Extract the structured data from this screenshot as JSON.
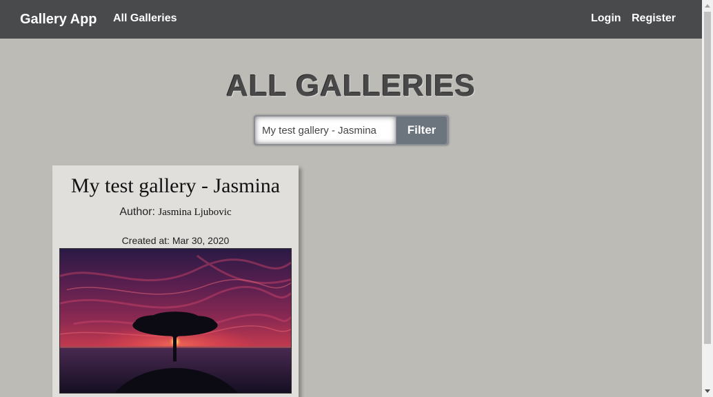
{
  "nav": {
    "brand": "Gallery App",
    "all_galleries": "All Galleries",
    "login": "Login",
    "register": "Register"
  },
  "page": {
    "title": "ALL GALLERIES"
  },
  "filter": {
    "input_value": "My test gallery - Jasmina",
    "button_label": "Filter"
  },
  "galleries": [
    {
      "title": "My test gallery - Jasmina",
      "author_label": "Author:",
      "author_name": "Jasmina Ljubovic",
      "created_label": "Created at:",
      "created_date": "Mar 30, 2020",
      "image_subject": "lone tree at sunset over water"
    }
  ],
  "colors": {
    "navbar_bg": "#484a4c",
    "page_bg": "#bcbbb6",
    "card_bg": "#e0dfdb",
    "filter_button_bg": "#6c757d"
  },
  "icons": {
    "scroll_up": "triangle-up-icon",
    "scroll_down": "triangle-down-icon"
  }
}
